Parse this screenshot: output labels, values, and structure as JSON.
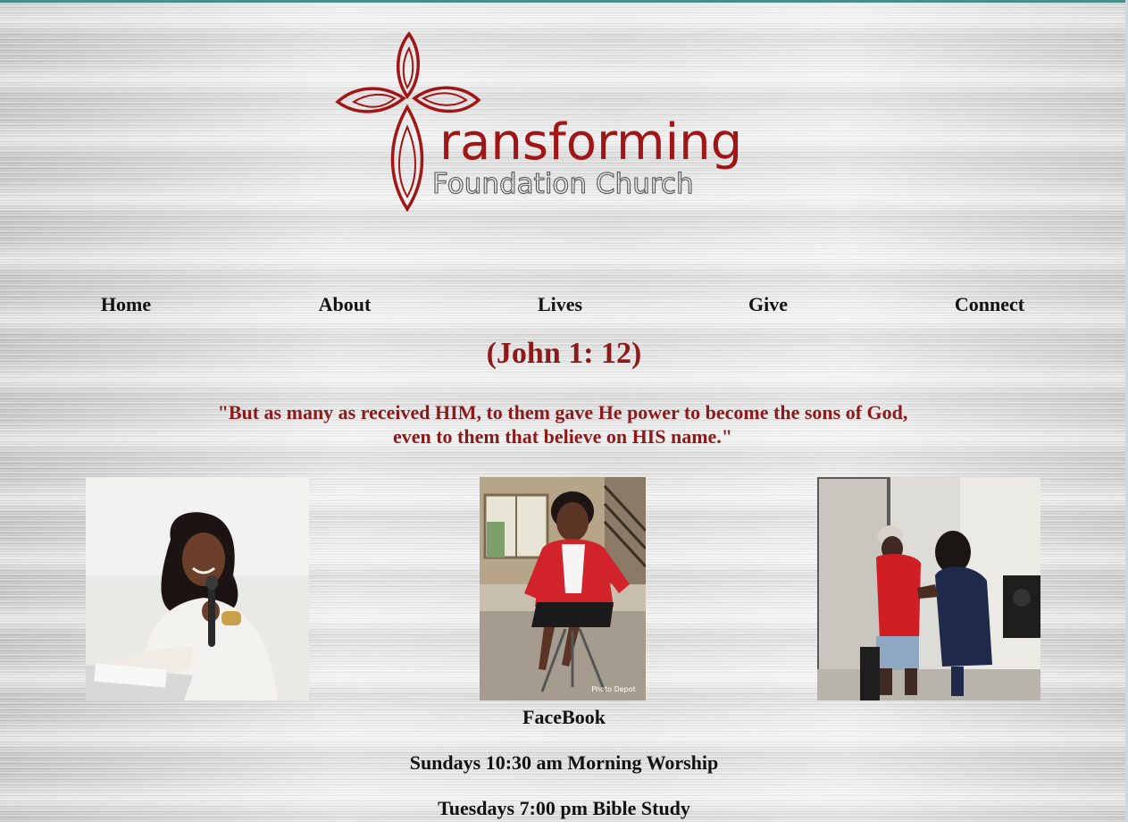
{
  "logo": {
    "title": "ransforming",
    "subtitle": "Foundation Church",
    "brand_color": "#a01515"
  },
  "nav": {
    "items": [
      {
        "label": "Home"
      },
      {
        "label": "About"
      },
      {
        "label": "Lives"
      },
      {
        "label": "Give"
      },
      {
        "label": "Connect"
      }
    ]
  },
  "verse": {
    "reference": "(John 1: 12)",
    "line1": "\"But as many as received HIM, to them gave He power to become the sons of God,",
    "line2": "even to them that believe on HIS name.\"",
    "color": "#8b1a1a"
  },
  "photos": [
    {
      "name": "woman-speaking-photo"
    },
    {
      "name": "woman-seated-red-jacket-photo",
      "caption": "Photo Depot"
    },
    {
      "name": "prayer-photo"
    }
  ],
  "info": {
    "facebook_label": "FaceBook",
    "sunday_service": "Sundays 10:30 am Morning Worship",
    "tuesday_service": "Tuesdays 7:00 pm Bible Study"
  }
}
